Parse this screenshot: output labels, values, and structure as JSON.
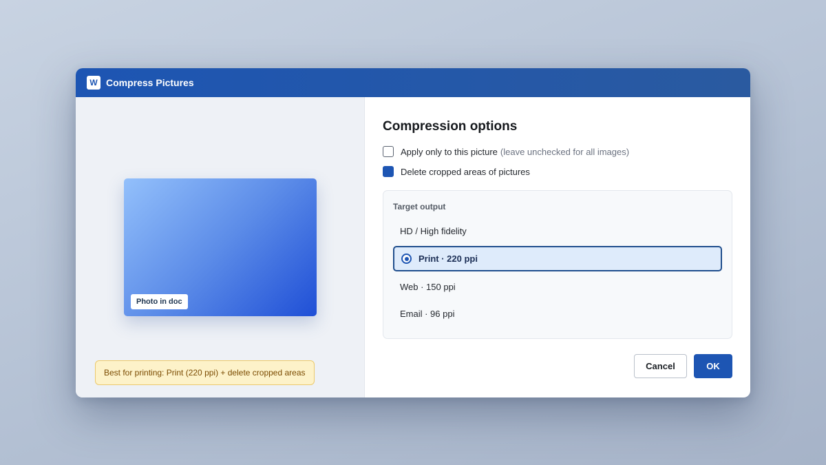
{
  "window": {
    "app_icon_letter": "W",
    "title": "Compress Pictures"
  },
  "preview": {
    "photo_label": "Photo in doc",
    "tip": "Best for printing: Print (220 ppi) + delete cropped areas"
  },
  "options": {
    "heading": "Compression options",
    "apply_only": {
      "label": "Apply only to this picture",
      "hint": "(leave unchecked for all images)",
      "checked": false
    },
    "delete_cropped": {
      "label": "Delete cropped areas of pictures",
      "checked": true
    }
  },
  "target_output": {
    "label": "Target output",
    "choices": [
      {
        "label": "HD / High fidelity",
        "selected": false
      },
      {
        "label": "Print · 220 ppi",
        "selected": true
      },
      {
        "label": "Web · 150 ppi",
        "selected": false
      },
      {
        "label": "Email · 96 ppi",
        "selected": false
      }
    ]
  },
  "buttons": {
    "cancel": "Cancel",
    "ok": "OK"
  },
  "colors": {
    "accent": "#1d55b3",
    "tip_background": "#fdf2c9",
    "selected_background": "#deebfb"
  }
}
